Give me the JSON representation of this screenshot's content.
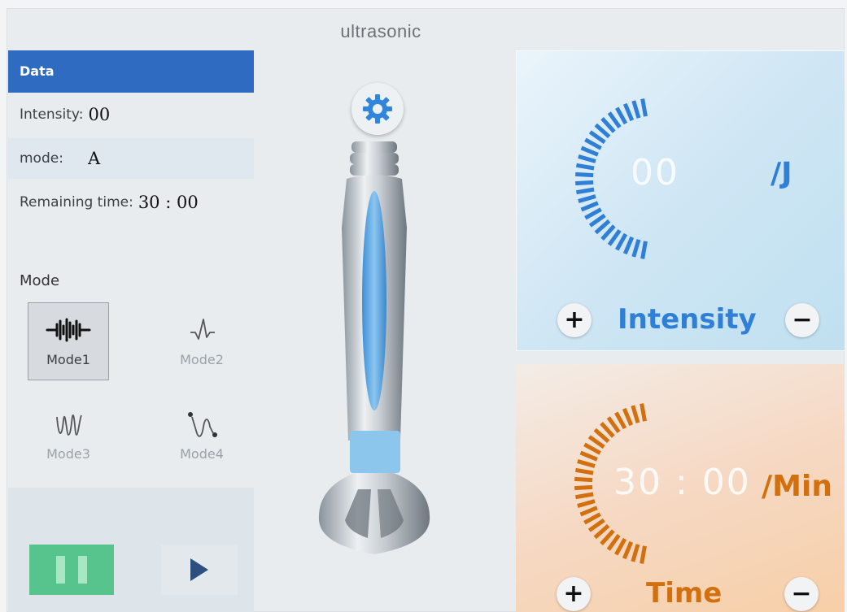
{
  "header": {
    "title": "ultrasonic"
  },
  "data_panel": {
    "title": "Data",
    "intensity_label": "Intensity:",
    "intensity_value": "00",
    "mode_label": "mode:",
    "mode_value": "A",
    "remaining_label": "Remaining time:",
    "remaining_value": "30 : 00"
  },
  "modes": {
    "title": "Mode",
    "items": [
      {
        "label": "Mode1",
        "icon": "waveform-burst-icon",
        "active": true
      },
      {
        "label": "Mode2",
        "icon": "waveform-spike-icon",
        "active": false
      },
      {
        "label": "Mode3",
        "icon": "waveform-sine-icon",
        "active": false
      },
      {
        "label": "Mode4",
        "icon": "waveform-dot-icon",
        "active": false
      }
    ]
  },
  "controls": {
    "pause_icon": "pause-icon",
    "play_icon": "play-icon"
  },
  "intensity_panel": {
    "value": "00",
    "unit": "/J",
    "label": "Intensity",
    "plus": "+",
    "minus": "−",
    "color": "#2f7fd6"
  },
  "time_panel": {
    "value": "30 : 00",
    "unit": "/Min",
    "label": "Time",
    "plus": "+",
    "minus": "−",
    "color": "#d2700f"
  }
}
